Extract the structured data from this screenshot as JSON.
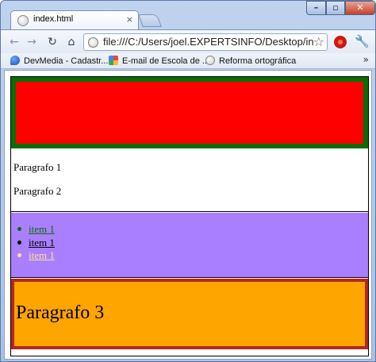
{
  "tab": {
    "title": "index.html",
    "close_glyph": "×"
  },
  "window_controls": {
    "minimize_glyph": "–",
    "maximize_glyph": "▫",
    "close_glyph": "✕"
  },
  "toolbar": {
    "back_glyph": "←",
    "forward_glyph": "→",
    "reload_glyph": "↻",
    "home_glyph": "⌂",
    "url": "file:///C:/Users/joel.EXPERTSINFO/Desktop/index.html",
    "star_glyph": "☆",
    "wrench_glyph": "🔧"
  },
  "bookmarks": {
    "items": [
      {
        "label": "DevMedia - Cadastr..."
      },
      {
        "label": "E-mail de Escola de ..."
      },
      {
        "label": "Reforma ortográfica"
      }
    ],
    "more_glyph": "»"
  },
  "page": {
    "paragraphs": [
      "Paragrafo 1",
      "Paragrafo 2"
    ],
    "list_items": [
      "item 1",
      "item 1",
      "item 1"
    ],
    "footer_text": "Paragrafo 3"
  },
  "colors": {
    "header_bg": "#ff0000",
    "header_border": "#0a6d0a",
    "list_bg": "#aa7fff",
    "footer_bg": "#ffa500",
    "footer_border": "#b5281e"
  }
}
